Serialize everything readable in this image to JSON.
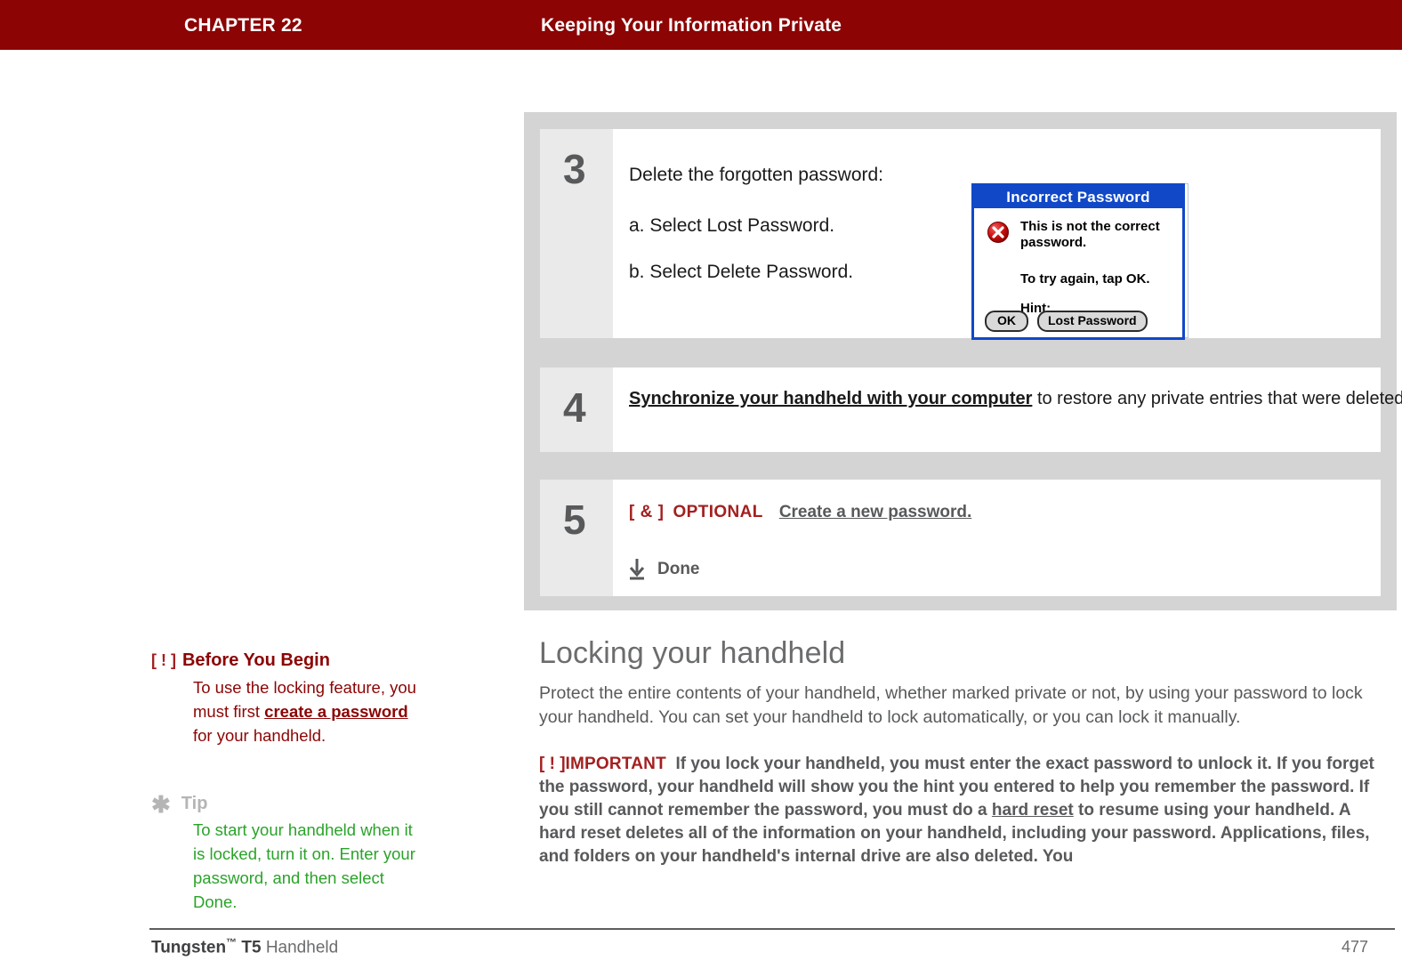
{
  "header": {
    "chapter": "CHAPTER 22",
    "title": "Keeping Your Information Private"
  },
  "steps": [
    {
      "number": "3",
      "intro": "Delete the forgotten password:",
      "sub_a": "a.  Select Lost Password.",
      "sub_b": "b.  Select Delete Password."
    },
    {
      "number": "4",
      "link_text": "Synchronize your handheld with your computer",
      "rest_text": " to restore any private entries that were deleted."
    },
    {
      "number": "5",
      "marker": "[ & ]",
      "optional_label": "OPTIONAL",
      "link_text": "Create a new password.",
      "done_label": "Done"
    }
  ],
  "palm_dialog": {
    "title": "Incorrect Password",
    "icon": "error-x-icon",
    "message_line1": "This is not the correct password.",
    "message_line2": "To try again, tap OK.",
    "message_line3": "Hint:",
    "buttons": [
      "OK",
      "Lost Password"
    ]
  },
  "sidebar": {
    "before_you_begin": {
      "marker": "[ ! ]",
      "title": "Before You Begin",
      "text_before": "To use the locking feature, you must first ",
      "link_text": "create a password",
      "text_after": " for your handheld."
    },
    "tip": {
      "icon": "asterisk-icon",
      "title": "Tip",
      "text": "To start your handheld when it is locked, turn it on. Enter your password, and then select Done."
    }
  },
  "article": {
    "heading": "Locking your handheld",
    "paragraph": "Protect the entire contents of your handheld, whether marked private or not, by using your password to lock your handheld. You can set your handheld to lock automatically, or you can lock it manually.",
    "important": {
      "marker": "[ ! ]",
      "label": "IMPORTANT",
      "text_before": "If you lock your handheld, you must enter the exact password to unlock it. If you forget the password, your handheld will show you the hint you entered to help you remember the password. If you still cannot remember the password, you must do a ",
      "link_text": "hard reset",
      "text_after": " to resume using your handheld. A hard reset deletes all of the information on your handheld, including your password. Applications, files, and folders on your handheld's internal drive are also deleted. You"
    }
  },
  "footer": {
    "brand": "Tungsten",
    "tm": "™",
    "model": " T5",
    "product": " Handheld",
    "page_number": "477"
  },
  "colors": {
    "header_red": "#8c0404",
    "accent_red": "#a32020",
    "panel_gray": "#d4d4d4",
    "number_cell_gray": "#eaeaea",
    "text_gray": "#58595b",
    "tip_green": "#2aa32a",
    "dialog_blue": "#1048c8"
  }
}
